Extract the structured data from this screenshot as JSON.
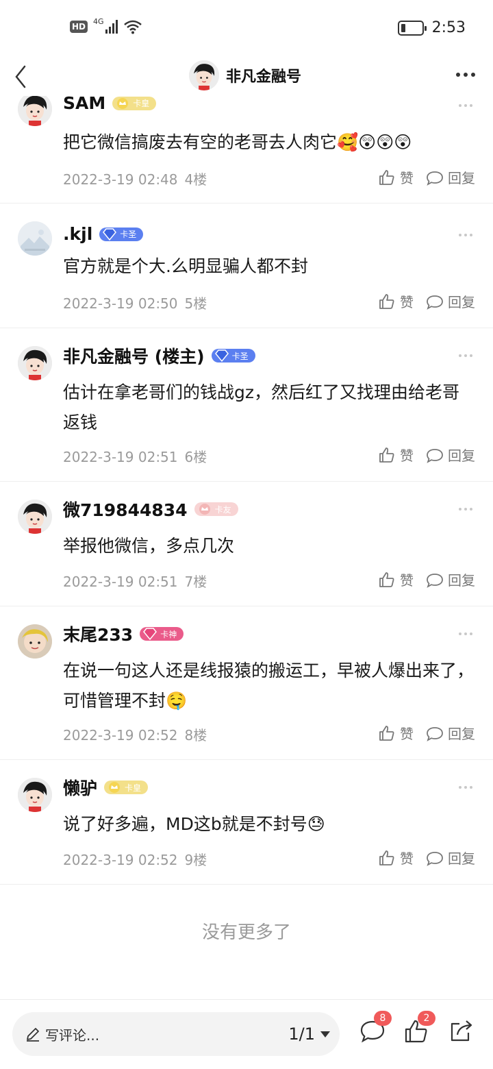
{
  "status_bar": {
    "hd": "HD",
    "network": "4G",
    "time": "2:53"
  },
  "header": {
    "title": "非凡金融号"
  },
  "comments": [
    {
      "name": "SAM",
      "badge": "卡皇",
      "text": "把它微信搞废去有空的老哥去人肉它🥰😲😲😲",
      "date": "2022-3-19 02:48",
      "floor": "4楼",
      "like": "赞",
      "reply": "回复"
    },
    {
      "name": ".kjl",
      "badge": "卡圣",
      "text": "官方就是个大.么明显骗人都不封",
      "date": "2022-3-19 02:50",
      "floor": "5楼",
      "like": "赞",
      "reply": "回复"
    },
    {
      "name": "非凡金融号 (楼主)",
      "badge": "卡圣",
      "text": "估计在拿老哥们的钱战gz，然后红了又找理由给老哥返钱",
      "date": "2022-3-19 02:51",
      "floor": "6楼",
      "like": "赞",
      "reply": "回复"
    },
    {
      "name": "微719844834",
      "badge": "卡友",
      "text": "举报他微信，多点几次",
      "date": "2022-3-19 02:51",
      "floor": "7楼",
      "like": "赞",
      "reply": "回复"
    },
    {
      "name": "末尾233",
      "badge": "卡神",
      "text": "在说一句这人还是线报猿的搬运工，早被人爆出来了，可惜管理不封🤤",
      "date": "2022-3-19 02:52",
      "floor": "8楼",
      "like": "赞",
      "reply": "回复"
    },
    {
      "name": "懒驴",
      "badge": "卡皇",
      "text": "说了好多遍，MD这b就是不封号😓",
      "date": "2022-3-19 02:52",
      "floor": "9楼",
      "like": "赞",
      "reply": "回复"
    }
  ],
  "end_text": "没有更多了",
  "bottom_bar": {
    "placeholder": "写评论...",
    "page": "1/1",
    "comment_count": "8",
    "like_count": "2"
  },
  "colors": {
    "badge_gold": "#f3d35a",
    "badge_blue": "#5b7ff0",
    "badge_pink_light": "#f6c4c4",
    "badge_pink": "#ea5b8a",
    "count_red": "#f05a5a"
  }
}
